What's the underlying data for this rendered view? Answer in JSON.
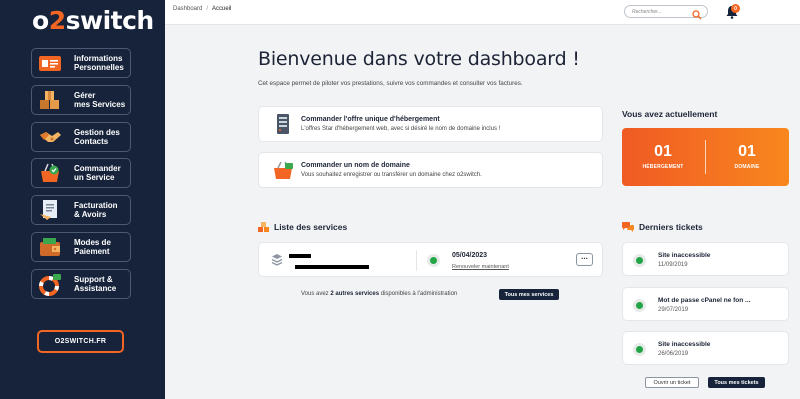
{
  "sidebar": {
    "logo": {
      "part1": "o",
      "part2": "2",
      "part3": "switch"
    },
    "items": [
      {
        "label": "Informations\nPersonnelles",
        "icon": "id-card-icon"
      },
      {
        "label": "Gérer\nmes Services",
        "icon": "boxes-icon"
      },
      {
        "label": "Gestion des\nContacts",
        "icon": "handshake-icon"
      },
      {
        "label": "Commander\nun Service",
        "icon": "shopping-basket-icon"
      },
      {
        "label": "Facturation\n& Avoirs",
        "icon": "invoice-icon"
      },
      {
        "label": "Modes de\nPaiement",
        "icon": "wallet-icon"
      },
      {
        "label": "Support &\nAssistance",
        "icon": "lifebuoy-icon"
      }
    ],
    "site_button": "O2SWITCH.FR"
  },
  "topbar": {
    "breadcrumb": [
      "Dashboard",
      "Accueil"
    ],
    "breadcrumb_sep": "/",
    "search_placeholder": "Rechercher...",
    "notifications_count": "0"
  },
  "main": {
    "title": "Bienvenue dans votre dashboard !",
    "subtitle": "Cet espace permet de piloter vos prestations, suivre vos commandes et consulter vos factures.",
    "actions": [
      {
        "title": "Commander l'offre unique d'hébergement",
        "desc": "L'offres Star d'hébergement web, avec si désiré le nom de domaine inclus !",
        "icon": "server-icon"
      },
      {
        "title": "Commander un nom de domaine",
        "desc": "Vous souhaitez enregistrer ou transférer un domaine chez o2switch.",
        "icon": "domain-basket-icon"
      }
    ],
    "summary": {
      "title": "Vous avez actuellement",
      "hosting_count": "01",
      "hosting_label": "HÉBERGEMENT",
      "domain_count": "01",
      "domain_label": "DOMAINE"
    },
    "services": {
      "title": "Liste des services",
      "item": {
        "date": "05/04/2023",
        "renew": "Renouveler maintenant",
        "status": "active"
      },
      "note_prefix": "Vous avez ",
      "note_bold": "2 autres services",
      "note_suffix": " disponibles à l'administration",
      "all_button": "Tous mes services"
    },
    "tickets": {
      "title": "Derniers tickets",
      "items": [
        {
          "title": "Site inaccessible",
          "date": "11/09/2019"
        },
        {
          "title": "Mot de passe cPanel ne fon ...",
          "date": "29/07/2019"
        },
        {
          "title": "Site inaccessible",
          "date": "26/06/2019"
        }
      ],
      "open_button": "Ouvrir un ticket",
      "all_button": "Tous mes tickets"
    }
  },
  "colors": {
    "sidebar_bg": "#16233b",
    "accent": "#f26522",
    "status_green": "#22a447"
  }
}
